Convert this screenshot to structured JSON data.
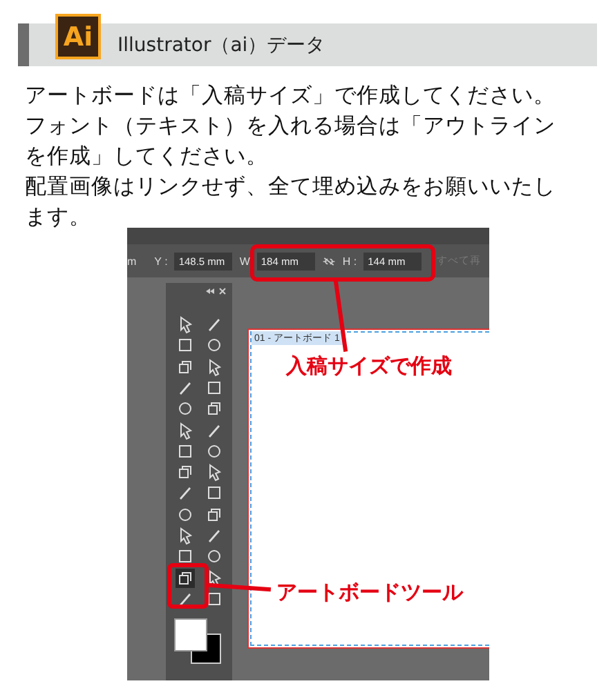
{
  "header": {
    "logo": "Ai",
    "title": "Illustrator（ai）データ"
  },
  "lines": [
    "アートボードは「入稿サイズ」で作成してください。",
    "フォント（テキスト）を入れる場合は「アウトライン",
    "を作成」してください。",
    "配置画像はリンクせず、全て埋め込みをお願いいたし",
    "ます。"
  ],
  "screenshot": {
    "control_bar": {
      "cut_unit": "m",
      "y_label": "Y :",
      "y_value": "148.5 mm",
      "w_label": "W",
      "w_value": "184 mm",
      "h_label": "H :",
      "h_value": "144 mm",
      "cut_button": "すべて再"
    },
    "artboard_label": "01 - アートボード 1",
    "callouts": [
      "入稿サイズで作成",
      "アートボードツール"
    ]
  }
}
